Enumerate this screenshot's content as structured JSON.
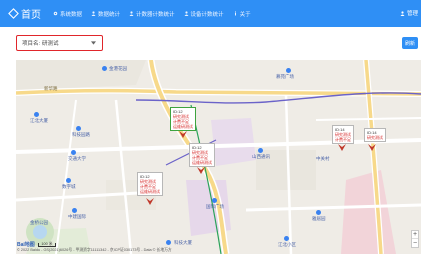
{
  "nav": {
    "brand_title": "首页",
    "items": [
      {
        "label": "系统数据",
        "icon": "gear-icon"
      },
      {
        "label": "数据统计",
        "icon": "user-icon"
      },
      {
        "label": "计数器计数统计",
        "icon": "user-icon"
      },
      {
        "label": "设备计数统计",
        "icon": "user-icon"
      },
      {
        "label": "关于",
        "icon": "info-icon"
      }
    ],
    "user_label": "管理"
  },
  "toolbar": {
    "project_label": "项目名:",
    "project_value": "研测试",
    "refresh_label": "刷新"
  },
  "map": {
    "pois": [
      "金港花园",
      "慕苑广场",
      "江北大厦",
      "科技园路",
      "交通大学",
      "数字城",
      "中建国际",
      "科技大厦",
      "国际广场",
      "山西通讯",
      "中关村",
      "雅居园",
      "江北小区",
      "金桥公园",
      "科技新区"
    ],
    "road_label": "新华路",
    "markers": [
      {
        "id": "ID:12",
        "lines": [
          "研究测试",
          "计费不足",
          "运维研测试"
        ],
        "color": "#3ea33e"
      },
      {
        "id": "ID:12",
        "lines": [
          "研究测试",
          "计费不足",
          "运维研测试"
        ],
        "color": "#b7b7b7"
      },
      {
        "id": "ID:12",
        "lines": [
          "研究测试",
          "计费不足",
          "运维研测试"
        ],
        "color": "#b7b7b7"
      },
      {
        "id": "ID:14",
        "lines": [
          "研究测试",
          "计费不足"
        ],
        "color": "#b7b7b7"
      },
      {
        "id": "ID:14",
        "lines": [
          "研究测试"
        ],
        "color": "#b7b7b7"
      }
    ],
    "scale_label": "100 米",
    "footer": "© 2022 Baidu - GS(2021)6026号 - 甲测资字11111342 - 京ICP证030173号 - Data © 长地万方",
    "baidu_logo": "Bai地图"
  },
  "colors": {
    "nav_bg": "#2f8ff5",
    "select_border": "#e0262b",
    "marker_text": "#d41f1f"
  }
}
